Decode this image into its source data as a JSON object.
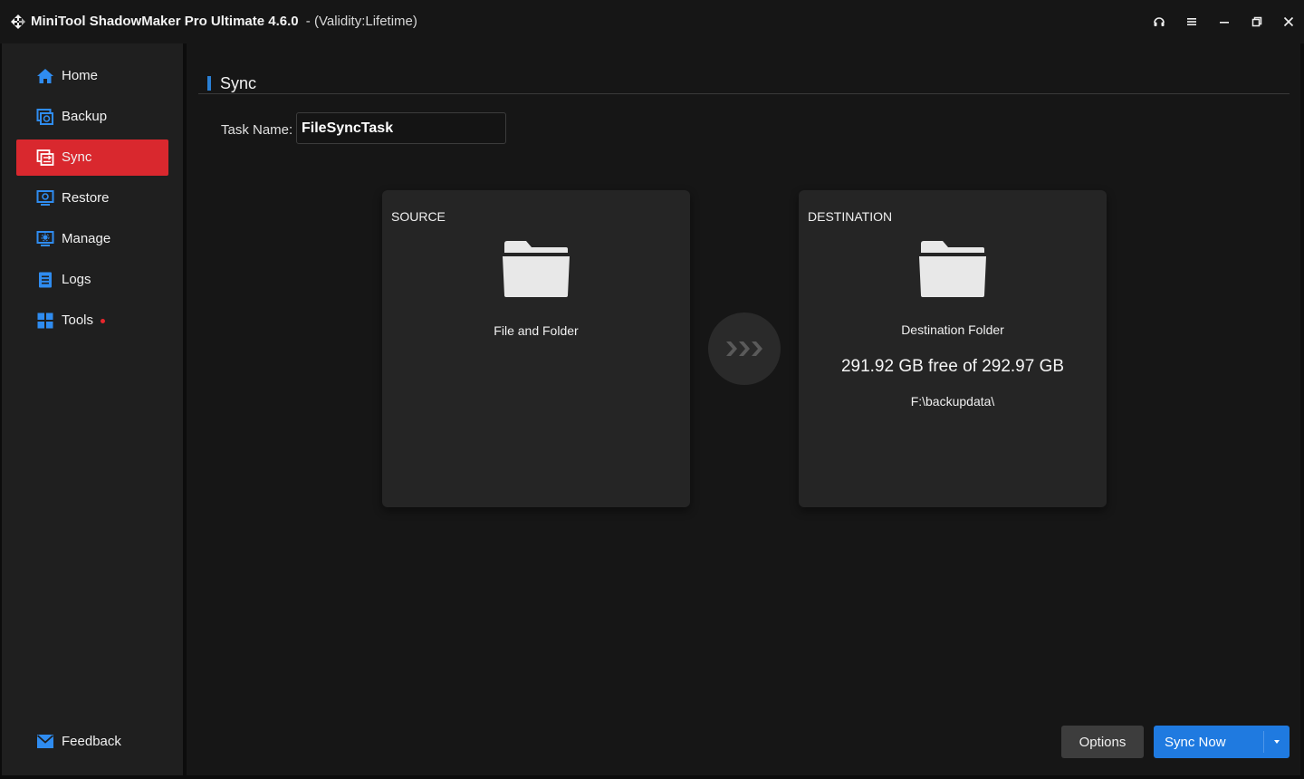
{
  "window": {
    "title": "MiniTool ShadowMaker Pro Ultimate 4.6.0",
    "validity": "- (Validity:Lifetime)",
    "controls": [
      "headset-icon",
      "menu-icon",
      "minimize-icon",
      "restore-icon",
      "close-icon"
    ]
  },
  "sidebar": {
    "items": [
      {
        "label": "Home",
        "icon": "home-icon",
        "active": false
      },
      {
        "label": "Backup",
        "icon": "backup-icon",
        "active": false
      },
      {
        "label": "Sync",
        "icon": "sync-icon",
        "active": true
      },
      {
        "label": "Restore",
        "icon": "restore-icon",
        "active": false
      },
      {
        "label": "Manage",
        "icon": "manage-icon",
        "active": false
      },
      {
        "label": "Logs",
        "icon": "logs-icon",
        "active": false
      },
      {
        "label": "Tools",
        "icon": "tools-icon",
        "active": false,
        "badge_dot": true
      }
    ],
    "feedback_label": "Feedback"
  },
  "main": {
    "section_title": "Sync",
    "task_name_label": "Task Name:",
    "task_name_value": "FileSyncTask",
    "source": {
      "heading": "SOURCE",
      "label": "File and Folder"
    },
    "destination": {
      "heading": "DESTINATION",
      "label": "Destination Folder",
      "free_space": "291.92 GB free of 292.97 GB",
      "path": "F:\\backupdata\\"
    },
    "options_label": "Options",
    "sync_now_label": "Sync Now"
  },
  "colors": {
    "accent_blue": "#2a7fd4",
    "active_red": "#d9282e",
    "primary_button": "#1f7ae0",
    "icon_blue": "#2f8cf0"
  }
}
